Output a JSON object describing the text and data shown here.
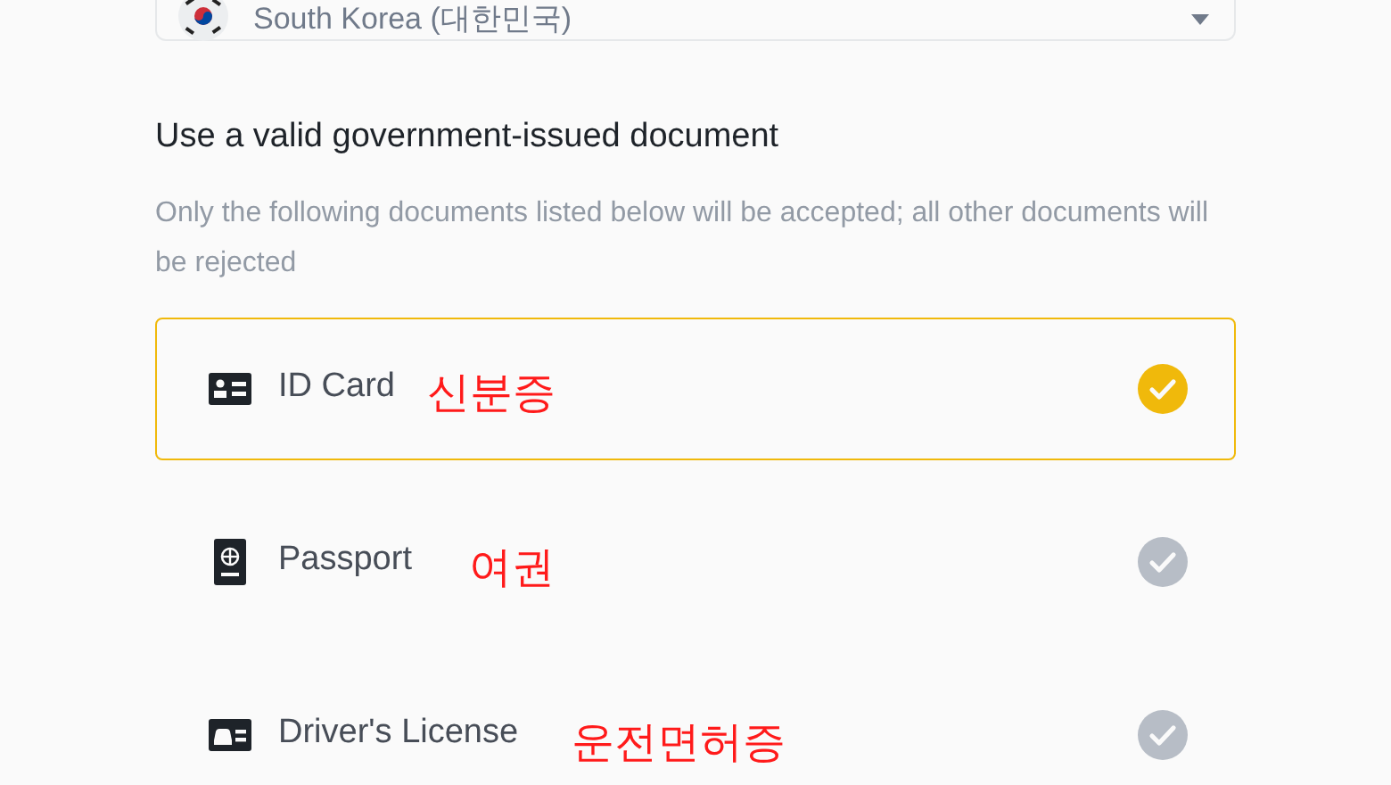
{
  "country_select": {
    "value": "South Korea (대한민국)"
  },
  "heading": "Use a valid government-issued document",
  "description": "Only the following documents listed below will be accepted; all other documents will be rejected",
  "documents": [
    {
      "kind": "id",
      "label": "ID Card",
      "selected": true,
      "annotation": "신분증"
    },
    {
      "kind": "passport",
      "label": "Passport",
      "selected": false,
      "annotation": "여권"
    },
    {
      "kind": "license",
      "label": "Driver's License",
      "selected": false,
      "annotation": "운전면허증"
    }
  ]
}
